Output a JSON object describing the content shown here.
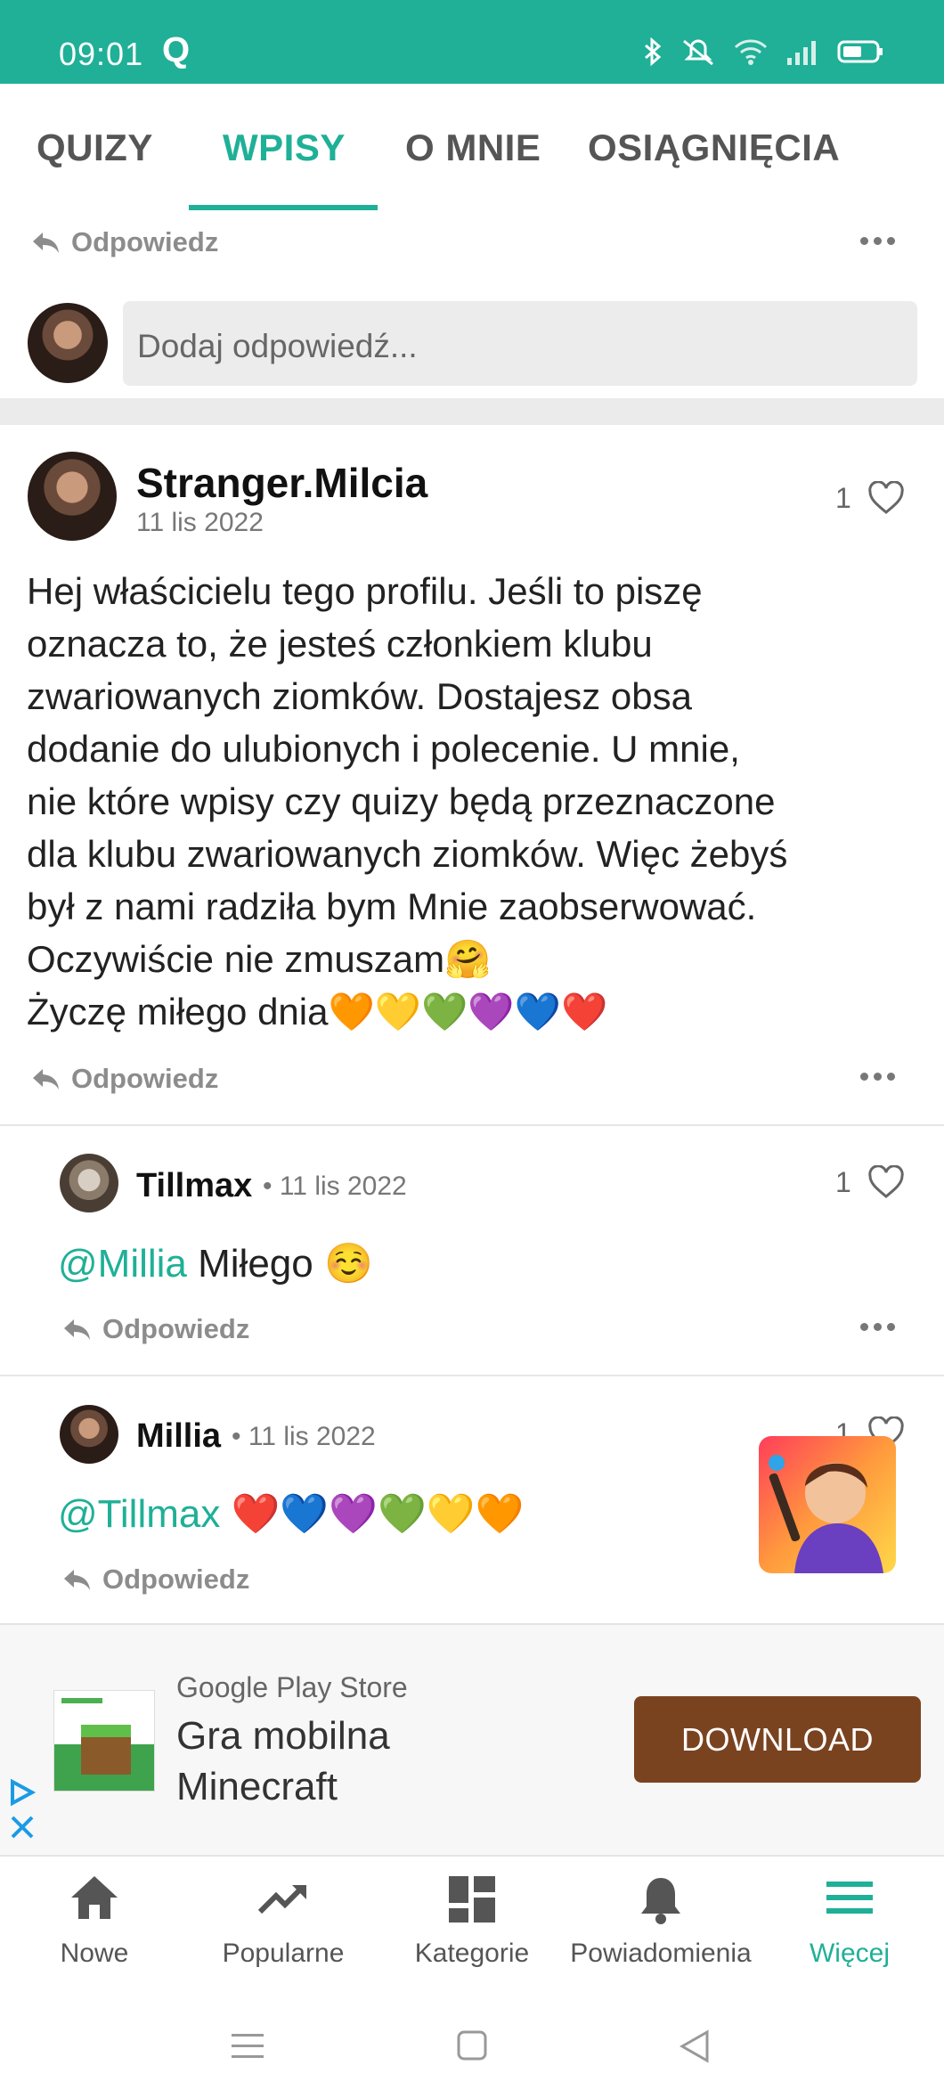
{
  "status_bar": {
    "time": "09:01",
    "app_glyph": "Q"
  },
  "tabs": [
    {
      "label": "QUIZY"
    },
    {
      "label": "WPISY"
    },
    {
      "label": "O MNIE"
    },
    {
      "label": "OSIĄGNIĘCIA"
    }
  ],
  "reply_label": "Odpowiedz",
  "reply_input": {
    "placeholder": "Dodaj odpowiedź..."
  },
  "post": {
    "author": "Stranger.Milcia",
    "date": "11 lis 2022",
    "likes": "1",
    "lines": [
      "Hej właścicielu tego profilu. Jeśli to piszę",
      "oznacza to, że jesteś członkiem klubu",
      "zwariowanych ziomków. Dostajesz obsa",
      "dodanie do ulubionych i polecenie. U mnie,",
      "nie które wpisy czy quizy będą przeznaczone",
      "dla klubu zwariowanych ziomków. Więc żebyś",
      "był z nami radziła bym Mnie zaobserwować.",
      "Oczywiście nie zmuszam🤗",
      "Życzę miłego dnia🧡💛💚💜💙❤️"
    ]
  },
  "comments": [
    {
      "author": "Tillmax",
      "date": "• 11 lis 2022",
      "likes": "1",
      "mention": "@Millia",
      "text": " Miłego ☺️"
    },
    {
      "author": "Millia",
      "date": "• 11 lis 2022",
      "likes": "1",
      "mention": "@Tillmax",
      "text": " ❤️💙💜💚💛🧡"
    }
  ],
  "banner_ad": {
    "store": "Google Play Store",
    "title_line1": "Gra mobilna",
    "title_line2": "Minecraft",
    "button": "DOWNLOAD"
  },
  "bottom_nav": [
    {
      "label": "Nowe",
      "icon": "home-icon"
    },
    {
      "label": "Popularne",
      "icon": "trending-icon"
    },
    {
      "label": "Kategorie",
      "icon": "grid-icon"
    },
    {
      "label": "Powiadomienia",
      "icon": "bell-icon"
    },
    {
      "label": "Więcej",
      "icon": "menu-icon"
    }
  ],
  "colors": {
    "accent": "#1fb097",
    "ad_button": "#7a4320"
  }
}
